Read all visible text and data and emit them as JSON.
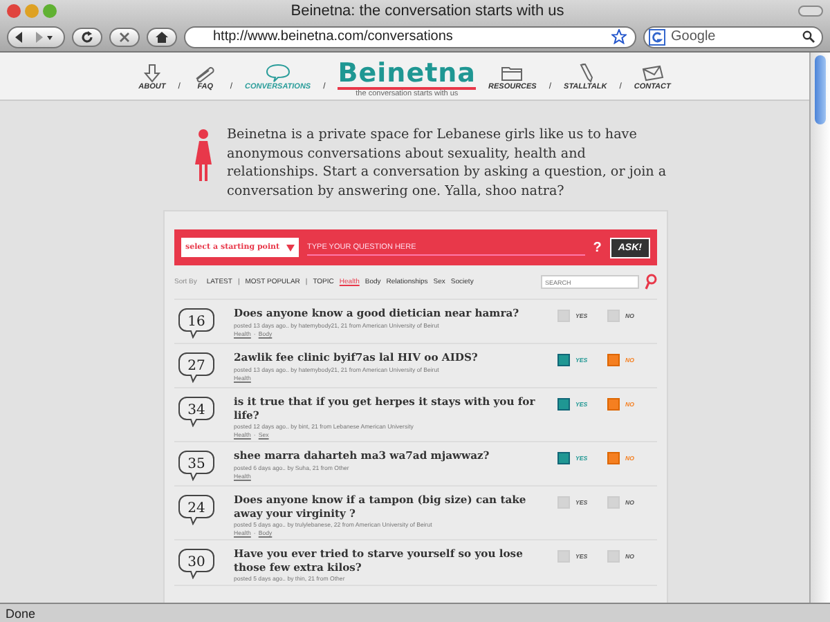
{
  "window": {
    "title": "Beinetna: the conversation starts with us"
  },
  "toolbar": {
    "url": "http://www.beinetna.com/conversations",
    "search_placeholder": "Google"
  },
  "nav": {
    "left": [
      {
        "label": "ABOUT",
        "selected": false
      },
      {
        "label": "FAQ",
        "selected": false
      },
      {
        "label": "CONVERSATIONS",
        "selected": true
      }
    ],
    "logo": "Beinetna",
    "tagline": "the conversation starts with us",
    "right": [
      {
        "label": "RESOURCES",
        "selected": false
      },
      {
        "label": "STALLTALK",
        "selected": false
      },
      {
        "label": "CONTACT",
        "selected": false
      }
    ],
    "separator": "/"
  },
  "intro": "Beinetna is a private space for Lebanese girls like us to have anonymous conversations about sexuality, health and relationships. Start a conversation by asking a question, or join a conversation by answering one. Yalla, shoo natra?",
  "ask": {
    "select": "select a starting point",
    "placeholder": "TYPE YOUR QUESTION HERE",
    "help": "?",
    "button": "ASK!"
  },
  "sort": {
    "label": "Sort By",
    "separator": "|",
    "options": [
      {
        "label": "LATEST",
        "kind": "main",
        "selected": false
      },
      {
        "label": "MOST POPULAR",
        "kind": "main",
        "selected": false
      },
      {
        "label": "TOPIC",
        "kind": "main",
        "selected": false
      },
      {
        "label": "Health",
        "kind": "topic",
        "selected": true
      },
      {
        "label": "Body",
        "kind": "topic",
        "selected": false
      },
      {
        "label": "Relationships",
        "kind": "topic",
        "selected": false
      },
      {
        "label": "Sex",
        "kind": "topic",
        "selected": false
      },
      {
        "label": "Society",
        "kind": "topic",
        "selected": false
      }
    ],
    "search_placeholder": "SEARCH"
  },
  "questions": [
    {
      "count": "16",
      "title": "Does anyone know a good dietician near hamra?",
      "meta": "posted 13 days ago.. by hatemybody21, 21 from American University of Beirut",
      "tags": [
        "Health",
        "Body"
      ],
      "yes": {
        "label": "YES",
        "on": false
      },
      "no": {
        "label": "NO",
        "on": false
      }
    },
    {
      "count": "27",
      "title": "2awlik fee clinic byif7as lal HIV oo AIDS?",
      "meta": "posted 13 days ago.. by hatemybody21, 21 from American University of Beirut",
      "tags": [
        "Health"
      ],
      "yes": {
        "label": "YES",
        "on": true
      },
      "no": {
        "label": "NO",
        "on": true
      }
    },
    {
      "count": "34",
      "title": "is it true that if you get herpes it stays with you for life?",
      "meta": "posted 12 days ago.. by bint, 21 from Lebanese American University",
      "tags": [
        "Health",
        "Sex"
      ],
      "yes": {
        "label": "YES",
        "on": true
      },
      "no": {
        "label": "NO",
        "on": true
      }
    },
    {
      "count": "35",
      "title": "shee marra daharteh ma3 wa7ad mjawwaz?",
      "meta": "posted 6 days ago.. by Suha, 21 from Other",
      "tags": [
        "Health"
      ],
      "yes": {
        "label": "YES",
        "on": true
      },
      "no": {
        "label": "NO",
        "on": true
      }
    },
    {
      "count": "24",
      "title": "Does anyone know if a tampon (big size) can take away your virginity ?",
      "meta": "posted 5 days ago.. by trulylebanese, 22 from American University of Beirut",
      "tags": [
        "Health",
        "Body"
      ],
      "yes": {
        "label": "YES",
        "on": false
      },
      "no": {
        "label": "NO",
        "on": false
      }
    },
    {
      "count": "30",
      "title": "Have you ever tried to starve yourself so you lose those few extra kilos?",
      "meta": "posted 5 days ago.. by thin, 21 from Other",
      "yes": {
        "label": "YES",
        "on": false
      },
      "no": {
        "label": "NO",
        "on": false
      }
    }
  ],
  "tag_separator": "·",
  "status_bar": "Done"
}
